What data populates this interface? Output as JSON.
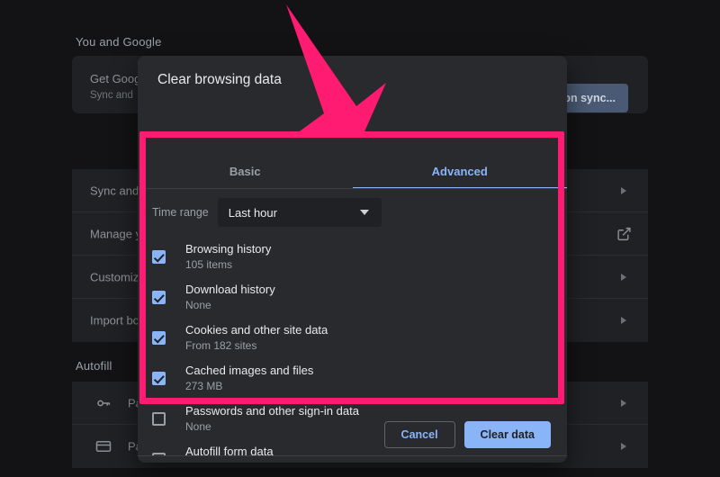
{
  "settings": {
    "sections": [
      {
        "title": "You and Google"
      },
      {
        "title": "Autofill"
      }
    ],
    "you_and_google": {
      "profile_title": "Get Goog",
      "profile_sub": "Sync and",
      "sync_button_label": "n on sync...",
      "rows": [
        {
          "label": "Sync and",
          "icon": "chevron-right-icon"
        },
        {
          "label": "Manage y",
          "icon": "external-link-icon"
        },
        {
          "label": "Customiz",
          "icon": "chevron-right-icon"
        },
        {
          "label": "Import bo",
          "icon": "chevron-right-icon"
        }
      ]
    },
    "autofill": {
      "rows": [
        {
          "label": "Pa",
          "icon": "key-icon"
        },
        {
          "label": "Pa",
          "icon": "credit-card-icon"
        }
      ]
    }
  },
  "dialog": {
    "title": "Clear browsing data",
    "tabs": [
      {
        "label": "Basic",
        "active": false
      },
      {
        "label": "Advanced",
        "active": true
      }
    ],
    "time_range": {
      "label": "Time range",
      "value": "Last hour",
      "caret_icon": "caret-down-icon"
    },
    "options": [
      {
        "title": "Browsing history",
        "sub": "105 items",
        "checked": true
      },
      {
        "title": "Download history",
        "sub": "None",
        "checked": true
      },
      {
        "title": "Cookies and other site data",
        "sub": "From 182 sites",
        "checked": true
      },
      {
        "title": "Cached images and files",
        "sub": "273 MB",
        "checked": true
      },
      {
        "title": "Passwords and other sign-in data",
        "sub": "None",
        "checked": false
      },
      {
        "title": "Autofill form data",
        "sub": "",
        "checked": false
      }
    ],
    "footer": {
      "cancel_label": "Cancel",
      "clear_label": "Clear data"
    }
  },
  "annotation": {
    "highlight_color": "#ff1a72",
    "arrow_color": "#ff1a72",
    "arrow_name": "pink-pointer-arrow",
    "highlight_name": "pink-highlight-box"
  },
  "colors": {
    "accent_blue": "#8ab4f8",
    "dialog_bg": "#292a2d",
    "page_bg": "#131315",
    "card_bg": "#202124"
  }
}
